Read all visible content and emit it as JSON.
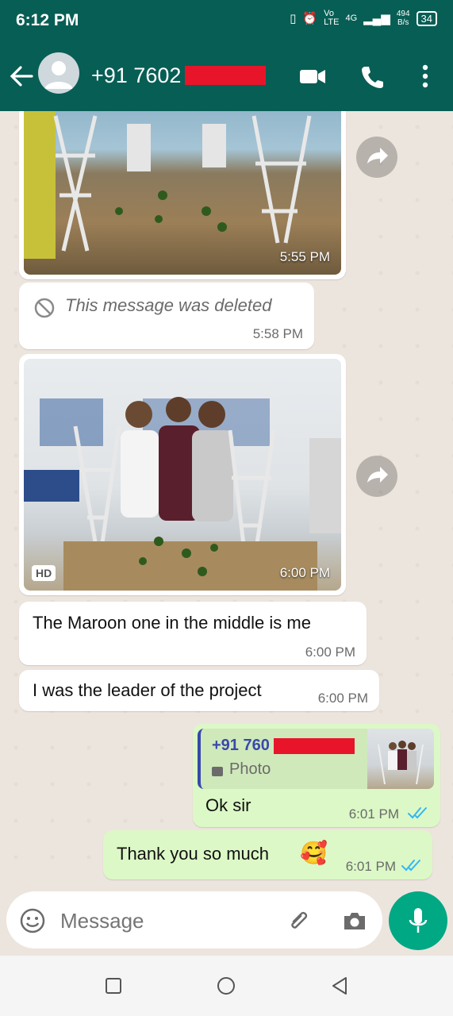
{
  "status_bar": {
    "time": "6:12 PM",
    "network_label": "4G",
    "speed_value": "494",
    "speed_unit": "B/s",
    "battery": "34"
  },
  "header": {
    "contact_name": "+91 7602"
  },
  "messages": [
    {
      "type": "image",
      "direction": "in",
      "time": "5:55 PM",
      "description_icon": "project-photo"
    },
    {
      "type": "deleted",
      "direction": "in",
      "text": "This message was deleted",
      "time": "5:58 PM"
    },
    {
      "type": "image",
      "direction": "in",
      "time": "6:00 PM",
      "badge": "HD"
    },
    {
      "type": "text",
      "direction": "in",
      "text": "The Maroon one in the middle is me",
      "time": "6:00 PM"
    },
    {
      "type": "text",
      "direction": "in",
      "text": "I was the leader of the project",
      "time": "6:00 PM"
    },
    {
      "type": "reply",
      "direction": "out",
      "quoted_sender": "+91 760",
      "quoted_type": "Photo",
      "text": "Ok sir",
      "time": "6:01 PM"
    },
    {
      "type": "text",
      "direction": "out",
      "text": "Thank you  so much",
      "emoji": "🥰",
      "time": "6:01 PM"
    }
  ],
  "composer": {
    "placeholder": "Message"
  },
  "colors": {
    "header": "#075E54",
    "chat_bg": "#ECE5DD",
    "outgoing_bubble": "#DCF8C6",
    "incoming_bubble": "#FFFFFF",
    "mic_button": "#00A884",
    "read_ticks": "#34B7F1",
    "quote_sender": "#3949ab"
  }
}
